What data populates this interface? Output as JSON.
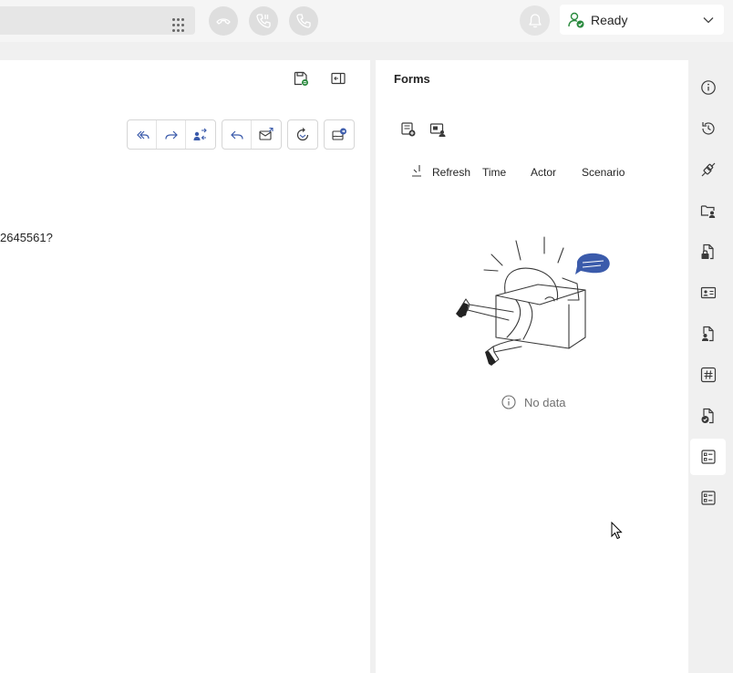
{
  "topbar": {
    "dialpad_icon": "dialpad-icon",
    "call_buttons": [
      "end-call-icon",
      "transfer-call-icon",
      "call-icon"
    ],
    "notifications_icon": "bell-icon",
    "status": {
      "label": "Ready",
      "icon": "presence-available-icon",
      "color": "#2a8a3e"
    }
  },
  "main": {
    "question_text": "2645561?",
    "toolbar_icons": [
      "save-icon",
      "collapse-panel-icon"
    ],
    "toolbar_groups": [
      [
        "reply-all-icon",
        "forward-icon",
        "assign-icon"
      ],
      [
        "reply-icon",
        "email-icon"
      ],
      [
        "refresh-icon"
      ],
      [
        "send-icon"
      ]
    ]
  },
  "forms": {
    "title": "Forms",
    "actions": [
      "add-form-icon",
      "form-assign-icon"
    ],
    "columns": [
      "Refresh",
      "Time",
      "Actor",
      "Scenario"
    ],
    "empty_text": "No data",
    "accent": "#3b5bab"
  },
  "rail": {
    "items": [
      "info-icon",
      "history-icon",
      "integration-icon",
      "folder-user-icon",
      "document-lock-icon",
      "contact-card-icon",
      "document-person-icon",
      "hashtag-icon",
      "document-check-icon",
      "forms-list-icon",
      "forms-list-icon"
    ],
    "active_index": 9
  }
}
